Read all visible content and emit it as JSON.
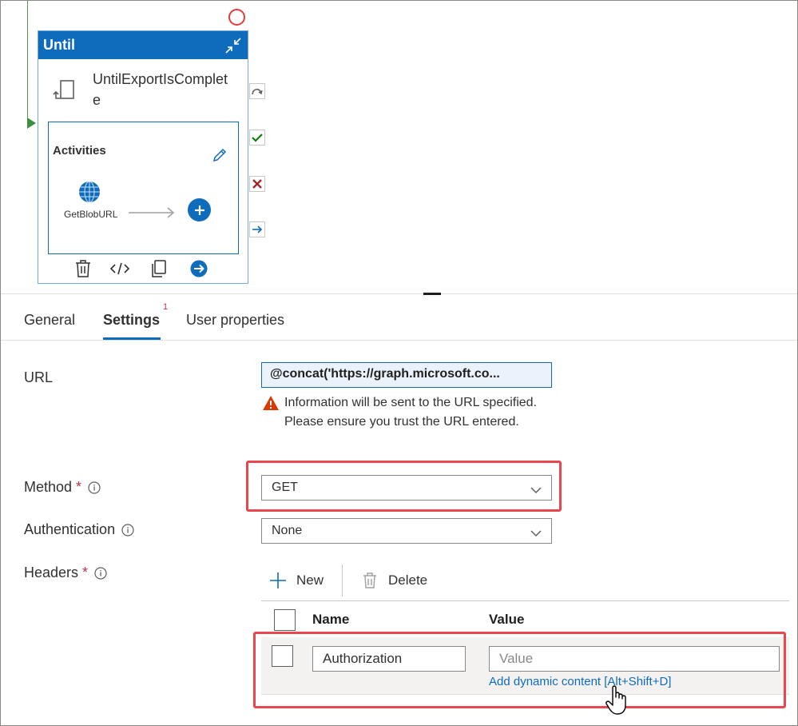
{
  "canvas": {
    "until_activity": {
      "type_label": "Until",
      "name": "UntilExportIsComplete",
      "activities_label": "Activities",
      "inner_activity": {
        "name": "GetBlobURL"
      }
    }
  },
  "tabs": [
    {
      "label": "General"
    },
    {
      "label": "Settings",
      "badge": "1"
    },
    {
      "label": "User properties"
    }
  ],
  "form": {
    "url": {
      "label": "URL",
      "value": "@concat('https://graph.microsoft.co...",
      "warning": "Information will be sent to the URL specified. Please ensure you trust the URL entered."
    },
    "method": {
      "label": "Method",
      "required": "*",
      "value": "GET"
    },
    "authentication": {
      "label": "Authentication",
      "value": "None"
    },
    "headers": {
      "label": "Headers",
      "required": "*",
      "new_label": "New",
      "delete_label": "Delete",
      "columns": {
        "name": "Name",
        "value": "Value"
      },
      "rows": [
        {
          "name": "Authorization",
          "value_placeholder": "Value",
          "dynamic_link": "Add dynamic content [Alt+Shift+D]"
        }
      ]
    }
  },
  "colors": {
    "accent": "#0f6cbd",
    "highlight": "#e8484d",
    "success": "#107c10",
    "error": "#a4262c",
    "warning": "#d83b01"
  }
}
